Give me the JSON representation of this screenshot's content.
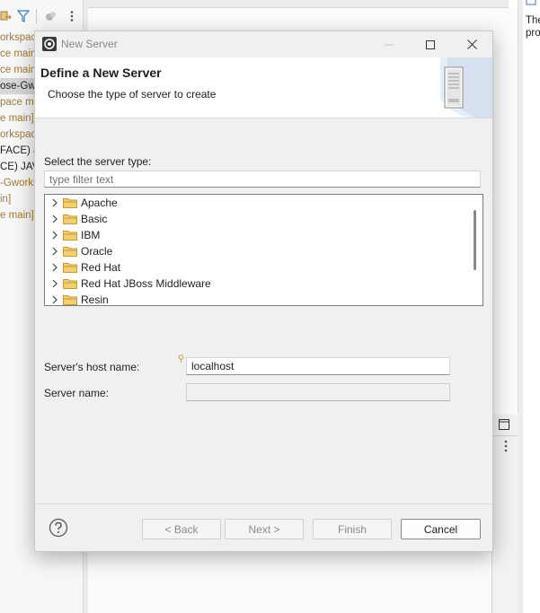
{
  "ide": {
    "project_items": [
      "orkspace",
      "ce main",
      "ce main",
      "ose-Gwor",
      "pace ma",
      "e main]",
      "orkspace",
      "FACE) JA",
      "CE) JAVA",
      "-Gworks",
      "in]",
      "e main]"
    ],
    "right_panel_text_1": "The",
    "right_panel_text_2": "pro"
  },
  "dialog": {
    "window_title": "New Server",
    "banner_title": "Define a New Server",
    "banner_description": "Choose the type of server to create",
    "server_type_label": "Select the server type:",
    "filter_placeholder": "type filter text",
    "server_types": [
      {
        "label": "Apache",
        "icon": "folder-icon"
      },
      {
        "label": "Basic",
        "icon": "folder-icon"
      },
      {
        "label": "IBM",
        "icon": "folder-icon"
      },
      {
        "label": "Oracle",
        "icon": "folder-icon"
      },
      {
        "label": "Red Hat",
        "icon": "folder-icon"
      },
      {
        "label": "Red Hat JBoss Middleware",
        "icon": "folder-icon"
      },
      {
        "label": "Resin",
        "icon": "folder-icon"
      }
    ],
    "host_label": "Server's host name:",
    "host_value": "localhost",
    "server_name_label": "Server name:",
    "server_name_value": "",
    "buttons": {
      "back": "< Back",
      "next": "Next >",
      "finish": "Finish",
      "cancel": "Cancel"
    },
    "help_icon": "question-mark-icon"
  },
  "colors": {
    "dialog_bg": "#f0f0f0",
    "banner_bg": "#ffffff",
    "project_text_gold": "#a07a30",
    "folder_yellow": "#e8b84a",
    "hint_orange": "#e8a020"
  }
}
